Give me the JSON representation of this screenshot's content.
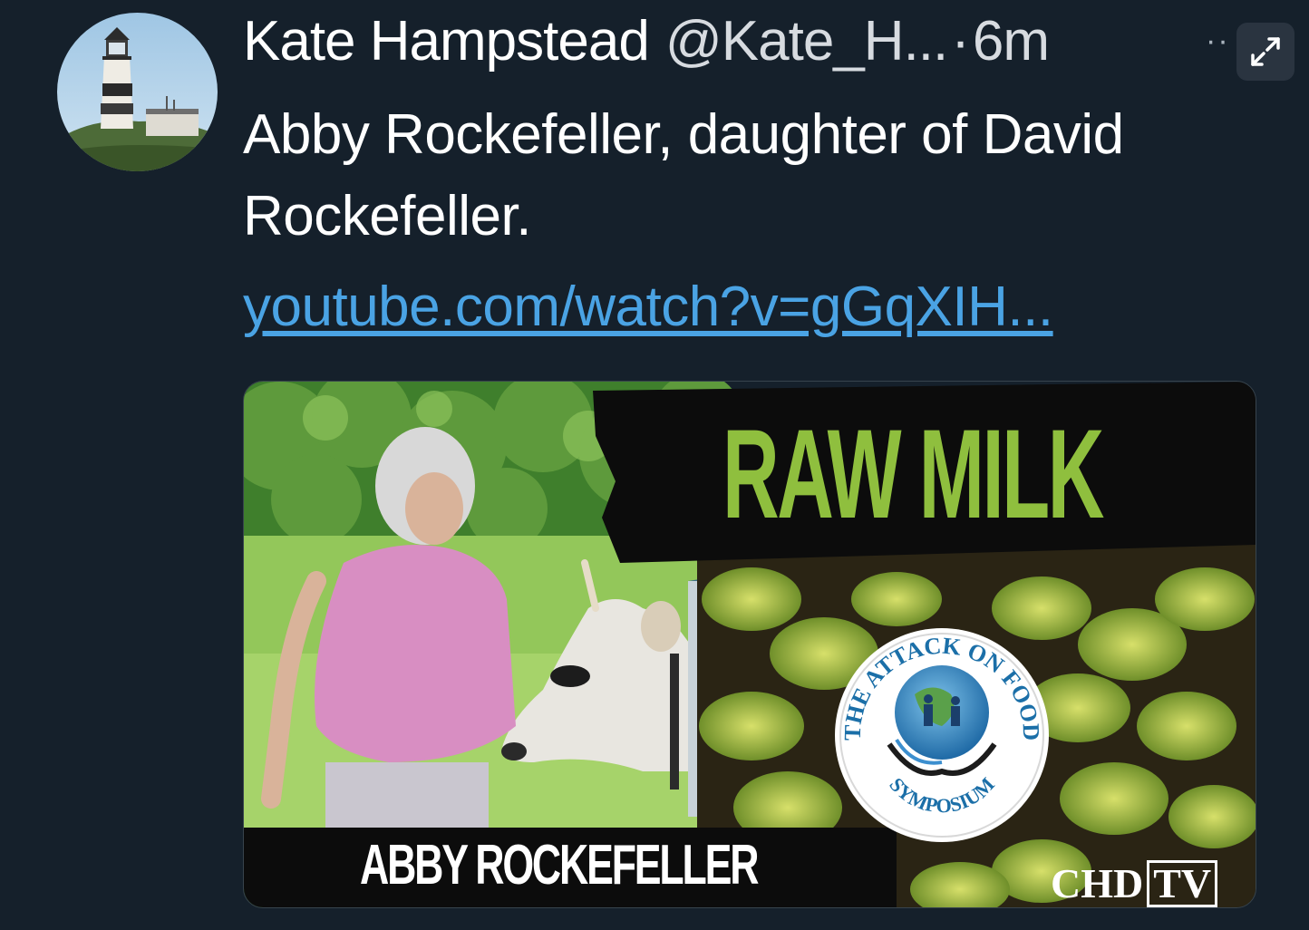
{
  "tweet": {
    "author_name": "Kate Hampstead",
    "handle": "@Kate_H...",
    "separator": "·",
    "time": "6m",
    "more": "··",
    "text": "Abby Rockefeller, daughter of David Rockefeller.",
    "link": "youtube.com/watch?v=gGqXIH..."
  },
  "card": {
    "thumbnail": {
      "title": "RAW MILK",
      "person_label": "ABBY ROCKEFELLER",
      "logo_top": "THE ATTACK ON FOOD",
      "logo_bottom": "SYMPOSIUM",
      "brand": "CHD",
      "brand_suffix": "TV"
    }
  },
  "icons": {
    "avatar": "lighthouse-photo",
    "expand": "expand-icon",
    "more": "more-icon"
  },
  "colors": {
    "background": "#15202b",
    "link": "#4aa3e4",
    "title_green": "#8fbf3e"
  }
}
